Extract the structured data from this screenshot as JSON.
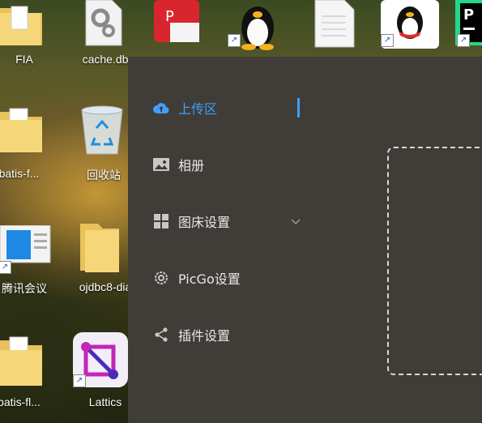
{
  "desktop": {
    "icons": [
      {
        "label": "FIA",
        "icon": "folder-icon"
      },
      {
        "label": "cache.db",
        "icon": "settings-file-icon"
      },
      {
        "label": "",
        "icon": "wps-pdf-icon"
      },
      {
        "label": "",
        "icon": "linux-penguin-icon"
      },
      {
        "label": "",
        "icon": "document-icon"
      },
      {
        "label": "",
        "icon": "qq-icon"
      },
      {
        "label": "",
        "icon": "pycharm-icon"
      },
      {
        "label": "ybatis-f...",
        "icon": "folder-icon"
      },
      {
        "label": "回收站",
        "icon": "recycle-bin-icon"
      },
      {
        "label": "腾讯会议",
        "icon": "tencent-meeting-icon"
      },
      {
        "label": "ojdbc8-dia",
        "icon": "folder-icon"
      },
      {
        "label": "ybatis-fl...",
        "icon": "folder-icon"
      },
      {
        "label": "Lattics",
        "icon": "lattics-icon"
      }
    ]
  },
  "picgo": {
    "menu": [
      {
        "label": "上传区",
        "icon": "upload-cloud-icon",
        "active": true
      },
      {
        "label": "相册",
        "icon": "picture-icon",
        "active": false
      },
      {
        "label": "图床设置",
        "icon": "grid-icon",
        "active": false,
        "expandable": true
      },
      {
        "label": "PicGo设置",
        "icon": "gear-icon",
        "active": false
      },
      {
        "label": "插件设置",
        "icon": "share-icon",
        "active": false
      }
    ]
  },
  "colors": {
    "window_bg": "#403c37",
    "accent": "#409eff",
    "menu_text": "#e8e8e8"
  }
}
